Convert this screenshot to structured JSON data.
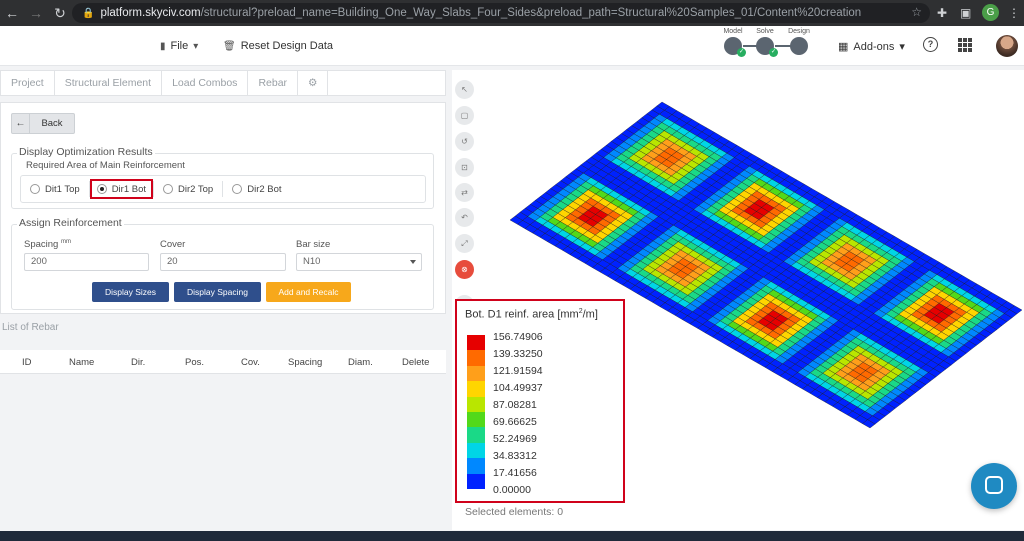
{
  "browser": {
    "url_host": "platform.skyciv.com",
    "url_path": "/structural?preload_name=Building_One_Way_Slabs_Four_Sides&preload_path=Structural%20Samples_01/Content%20creation",
    "profile_initial": "G"
  },
  "header": {
    "file_label": "File",
    "reset_label": "Reset Design Data",
    "steps": [
      "Model",
      "Solve",
      "Design"
    ],
    "addons_label": "Add-ons",
    "help_label": "?"
  },
  "tabs": [
    "Project",
    "Structural Element",
    "Load Combos",
    "Rebar"
  ],
  "back_label": "Back",
  "optimization": {
    "legend": "Display Optimization Results",
    "sublegend": "Required Area of Main Reinforcement",
    "options": [
      "Dit1 Top",
      "Dir1 Bot",
      "Dir2 Top",
      "Dir2 Bot"
    ],
    "selected": "Dir1 Bot"
  },
  "assign": {
    "legend": "Assign Reinforcement",
    "spacing_label": "Spacing",
    "spacing_unit": "mm",
    "spacing_value": "200",
    "cover_label": "Cover",
    "cover_value": "20",
    "barsize_label": "Bar size",
    "barsize_value": "N10",
    "btn_sizes": "Display Sizes",
    "btn_spacing": "Display Spacing",
    "btn_recalc": "Add and Recalc"
  },
  "rebar_list": {
    "title": "List of Rebar",
    "columns": [
      "ID",
      "Name",
      "Dir.",
      "Pos.",
      "Cov.",
      "Spacing",
      "Diam.",
      "Delete"
    ]
  },
  "legend_panel": {
    "title_prefix": "Bot. D1 reinf. area [mm",
    "title_sup": "2",
    "title_suffix": "/m]",
    "values": [
      "156.74906",
      "139.33250",
      "121.91594",
      "104.49937",
      "87.08281",
      "69.66625",
      "52.24969",
      "34.83312",
      "17.41656",
      "0.00000"
    ],
    "colors": [
      "#e60000",
      "#ff6a00",
      "#ff9f1a",
      "#ffd500",
      "#b9e600",
      "#52d91a",
      "#1ad987",
      "#00d5e6",
      "#0088ff",
      "#0022ff"
    ]
  },
  "selected_text": "Selected elements: 0"
}
